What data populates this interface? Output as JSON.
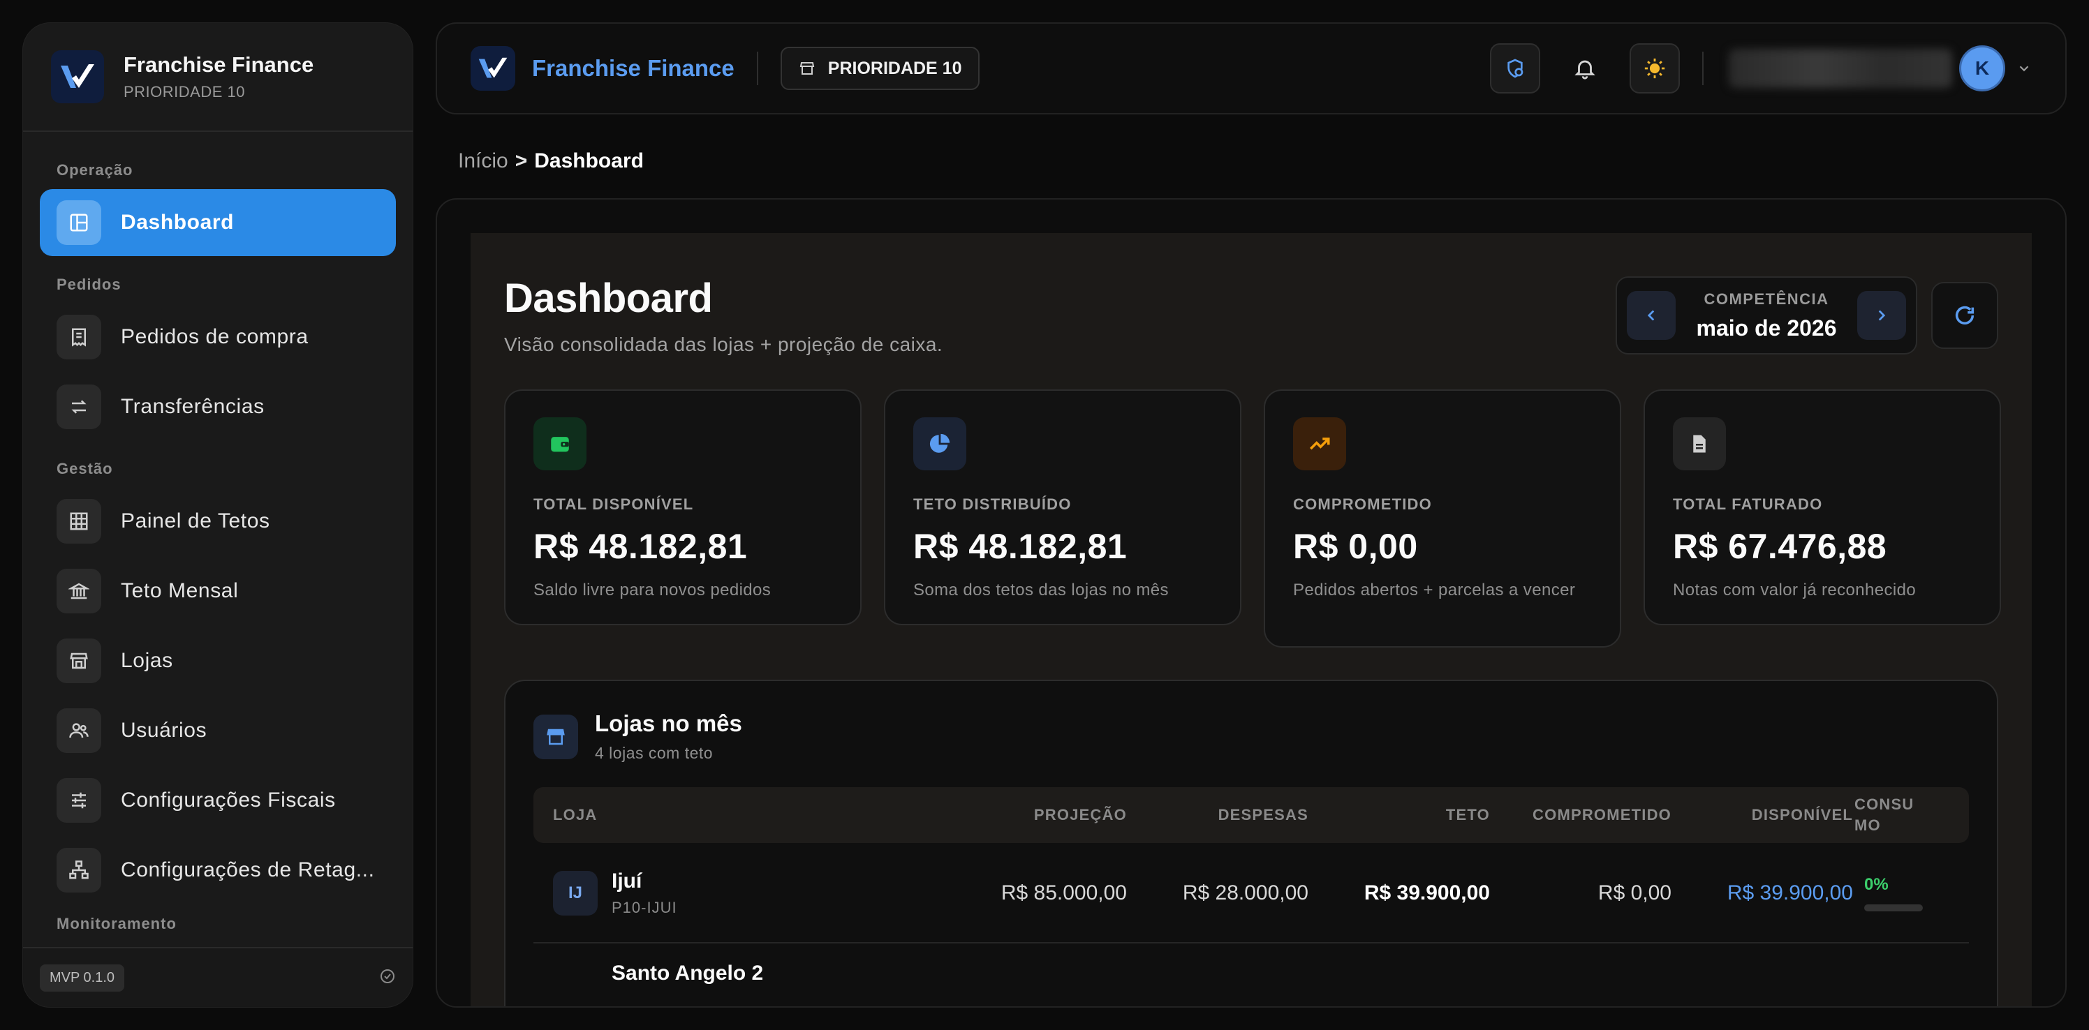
{
  "sidebar": {
    "brand_title": "Franchise Finance",
    "brand_sub": "PRIORIDADE 10",
    "sections": {
      "operacao": "Operação",
      "pedidos": "Pedidos",
      "gestao": "Gestão",
      "monitoramento": "Monitoramento"
    },
    "items": {
      "dashboard": "Dashboard",
      "pedidos_compra": "Pedidos de compra",
      "transferencias": "Transferências",
      "painel_tetos": "Painel de Tetos",
      "teto_mensal": "Teto Mensal",
      "lojas": "Lojas",
      "usuarios": "Usuários",
      "config_fiscais": "Configurações Fiscais",
      "config_retag": "Configurações de Retag..."
    },
    "version": "MVP 0.1.0"
  },
  "topbar": {
    "title": "Franchise Finance",
    "priority_pill": "PRIORIDADE 10",
    "avatar_initial": "K"
  },
  "breadcrumb": {
    "home": "Início",
    "separator": ">",
    "current": "Dashboard"
  },
  "page": {
    "title": "Dashboard",
    "subtitle": "Visão consolidada das lojas + projeção de caixa.",
    "competencia_label": "COMPETÊNCIA",
    "competencia_value": "maio de 2026"
  },
  "cards": [
    {
      "label": "TOTAL DISPONÍVEL",
      "value": "R$  48.182,81",
      "desc": "Saldo livre para novos pedidos",
      "icon": "wallet-icon",
      "color": "#22c55e"
    },
    {
      "label": "TETO DISTRIBUÍDO",
      "value": "R$  48.182,81",
      "desc": "Soma dos tetos das lojas no mês",
      "icon": "pie-chart-icon",
      "color": "#5b9cf0"
    },
    {
      "label": "COMPROMETIDO",
      "value": "R$  0,00",
      "desc": "Pedidos abertos + parcelas a vencer",
      "icon": "trending-up-icon",
      "color": "#f59e0b"
    },
    {
      "label": "TOTAL FATURADO",
      "value": "R$  67.476,88",
      "desc": "Notas com valor já reconhecido",
      "icon": "document-icon",
      "color": "#cfcfcf"
    }
  ],
  "stores": {
    "title": "Lojas no mês",
    "subtitle": "4 lojas com teto",
    "columns": {
      "loja": "LOJA",
      "projecao": "PROJEÇÃO",
      "despesas": "DESPESAS",
      "teto": "TETO",
      "comprometido": "COMPROMETIDO",
      "disponivel": "DISPONÍVEL",
      "consumo_1": "CONSU",
      "consumo_2": "MO"
    },
    "rows": [
      {
        "badge": "IJ",
        "name": "Ijuí",
        "code": "P10-IJUI",
        "projecao": "R$  85.000,00",
        "despesas": "R$  28.000,00",
        "teto": "R$  39.900,00",
        "comprometido": "R$  0,00",
        "disponivel": "R$  39.900,00",
        "consumo": "0%",
        "consumo_fraction": 0
      },
      {
        "name": "Santo Angelo 2"
      }
    ]
  },
  "colors": {
    "accent": "#2b8ae6",
    "brand_text": "#5b9cf0",
    "success": "#3ccf6c"
  }
}
